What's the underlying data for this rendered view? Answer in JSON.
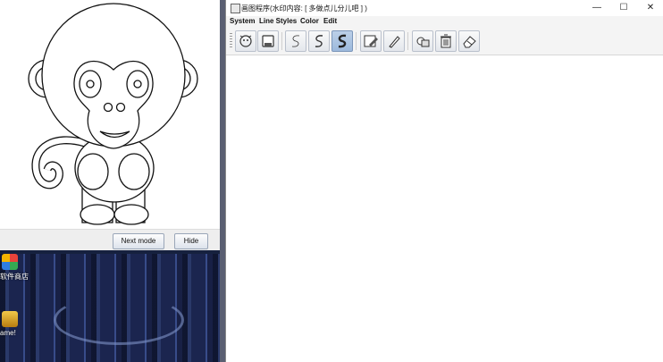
{
  "desktop": {
    "icons": [
      {
        "label": "软件商店",
        "icon": "store-icon",
        "color": "#e8433a"
      },
      {
        "label": "ame!",
        "icon": "game-icon",
        "color": "#d9a21b"
      }
    ]
  },
  "left_window": {
    "next_mode_label": "Next mode",
    "hide_label": "Hide"
  },
  "app": {
    "title": "画图程序(水印内容: [ 多做点儿分儿吧 ] )",
    "menus": [
      "System",
      "Line Styles",
      "Color",
      "Edit"
    ],
    "window_controls": {
      "minimize": "—",
      "maximize": "☐",
      "close": "✕"
    },
    "toolbar": {
      "tools": [
        {
          "icon": "open-image-icon",
          "selected": false
        },
        {
          "icon": "save-icon",
          "selected": false
        },
        {
          "icon": "thin-line-s-icon",
          "selected": false
        },
        {
          "icon": "medium-line-s-icon",
          "selected": false
        },
        {
          "icon": "thick-line-s-icon",
          "selected": true
        },
        {
          "icon": "image-edit-icon",
          "selected": false
        },
        {
          "icon": "pencil-icon",
          "selected": false
        },
        {
          "icon": "shape-fill-icon",
          "selected": false
        },
        {
          "icon": "trash-icon",
          "selected": false
        },
        {
          "icon": "eraser-icon",
          "selected": false
        }
      ]
    }
  }
}
